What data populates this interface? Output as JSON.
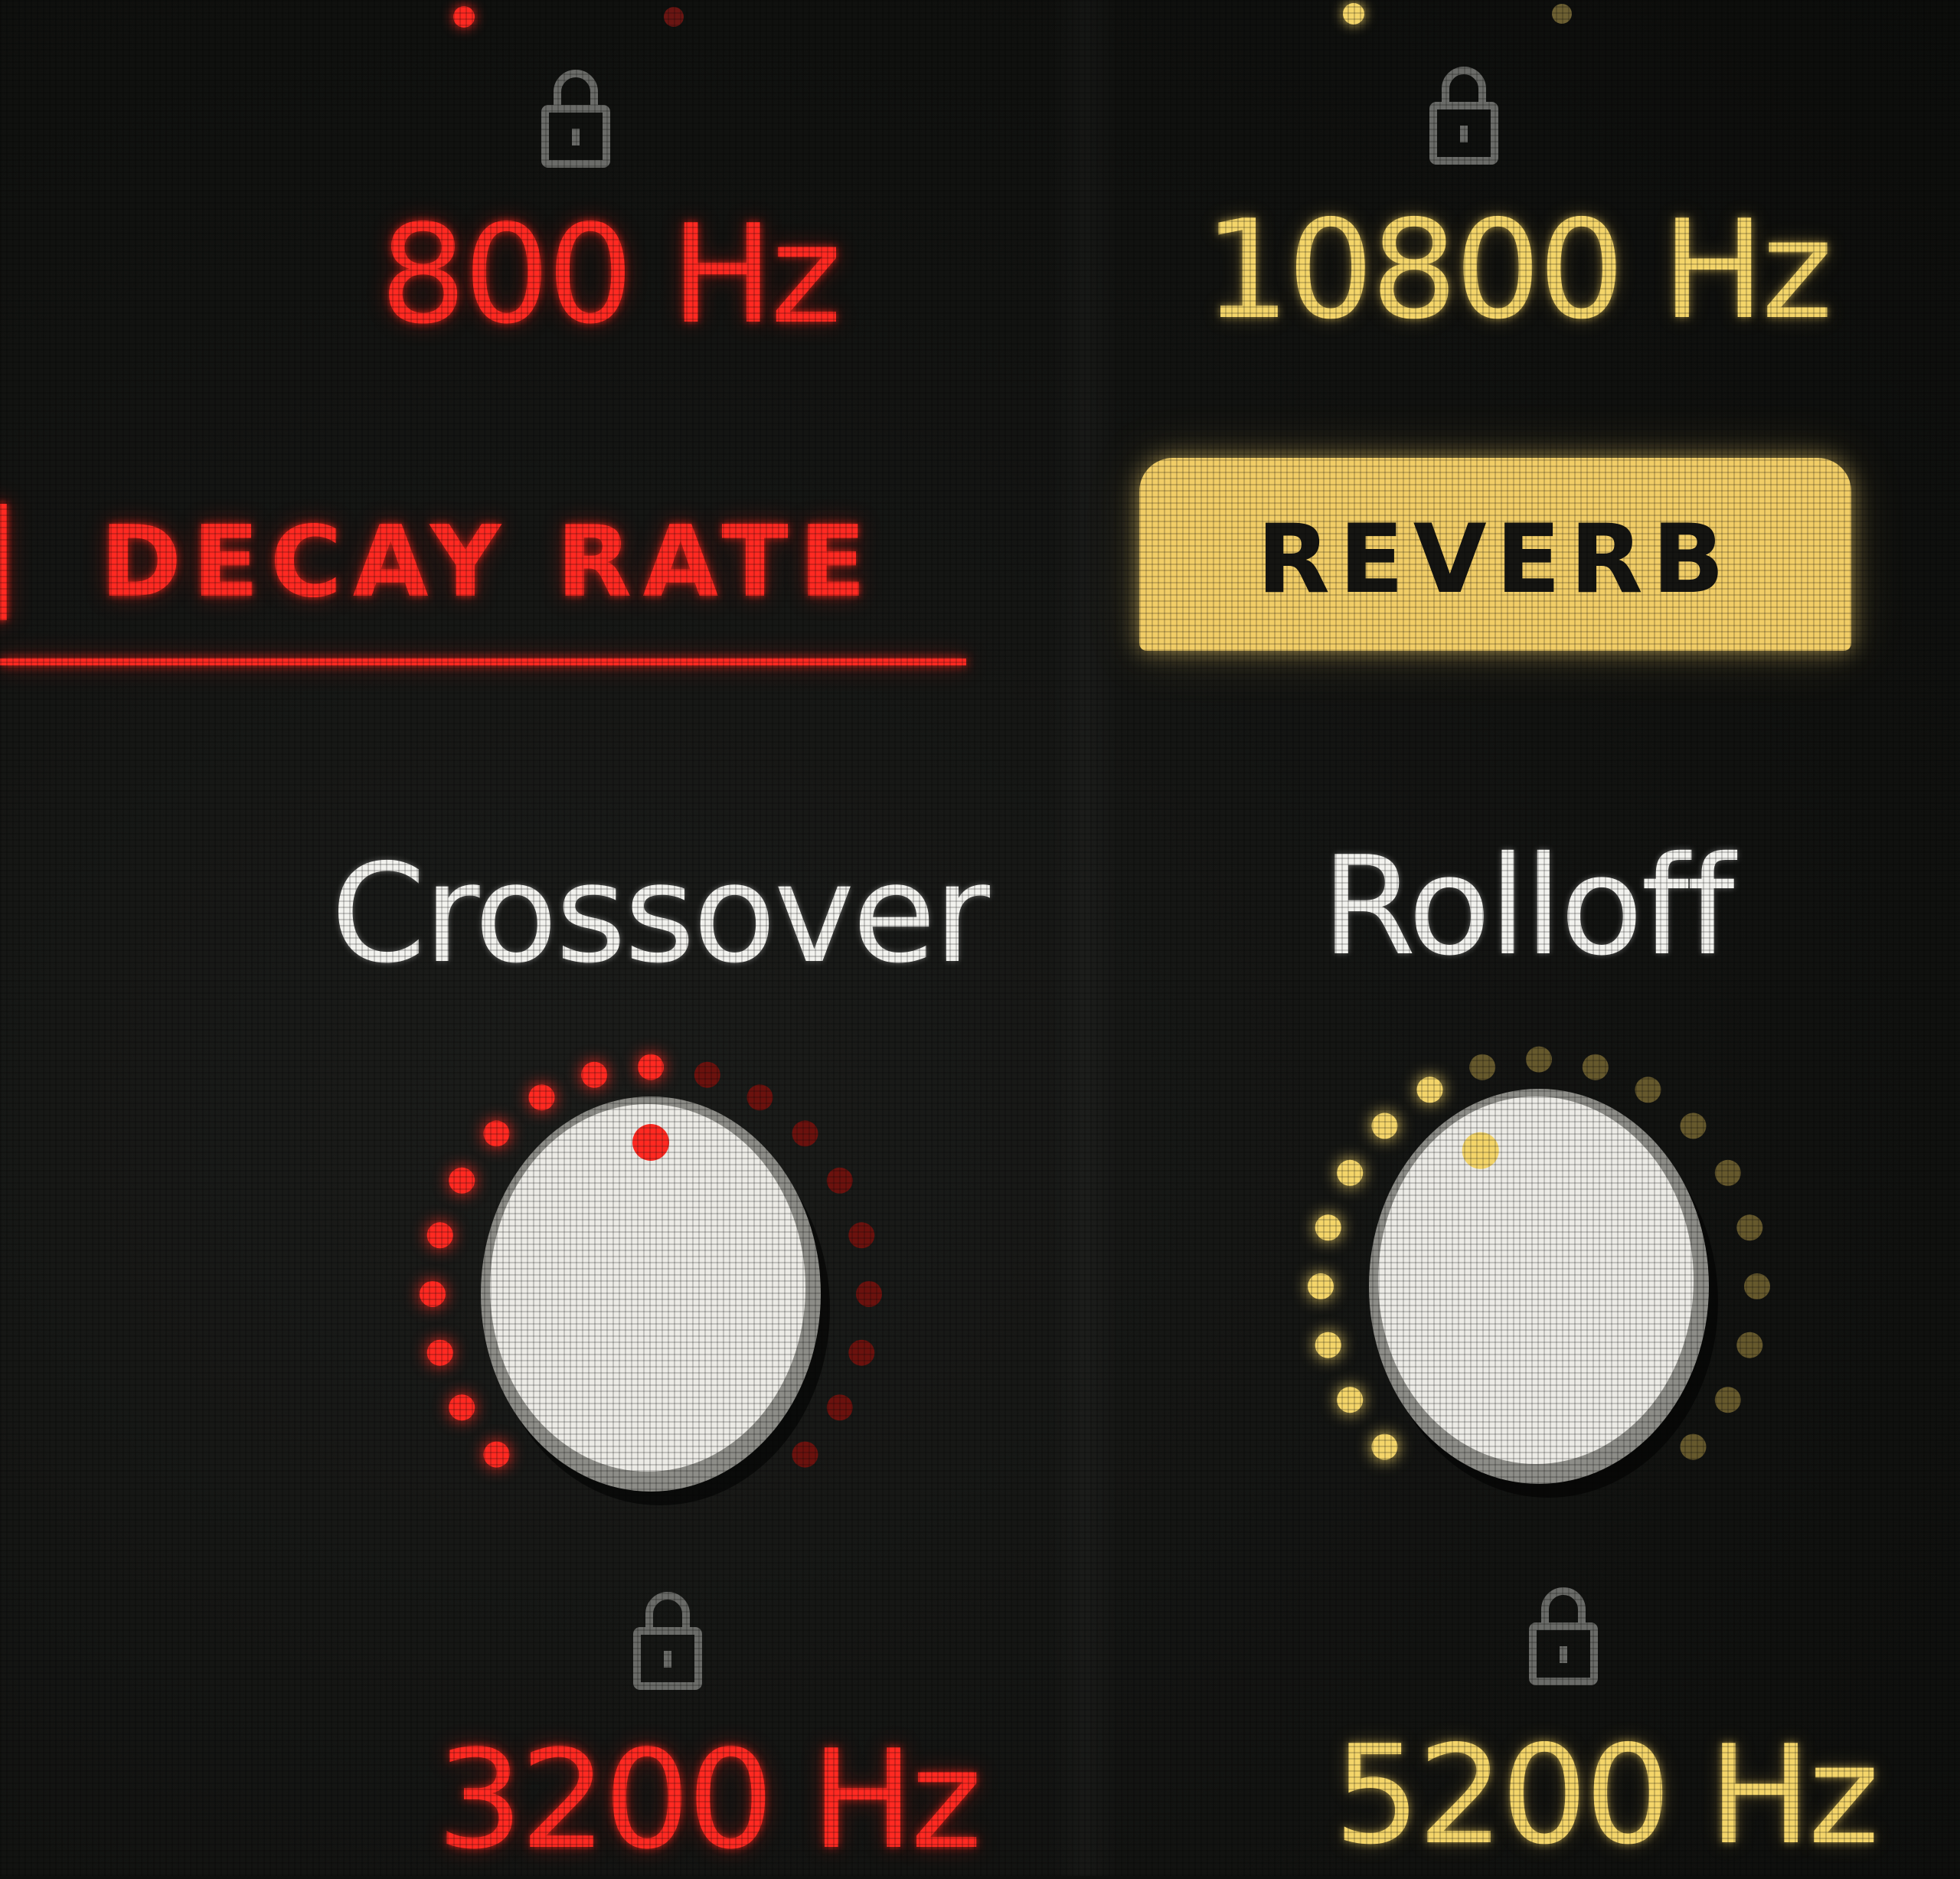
{
  "colors": {
    "red_accent": "#ff2a22",
    "yellow_accent": "#f4d56a",
    "reverb_button_bg": "#f1cd67",
    "background": "#121311",
    "knob_face": "#ecebe6"
  },
  "top_row": {
    "left_value": "800 Hz",
    "right_value": "10800 Hz",
    "left_lock_icon": "lock-icon",
    "right_lock_icon": "lock-icon"
  },
  "sections": {
    "decay_rate_label": "DECAY RATE",
    "reverb_label": "REVERB"
  },
  "knobs": {
    "crossover": {
      "title": "Crossover",
      "value": "3200 Hz",
      "color": "#ff2a22",
      "level": 0.5,
      "icon": "lock-icon"
    },
    "rolloff": {
      "title": "Rolloff",
      "value": "5200 Hz",
      "color": "#f4d56a",
      "level": 0.4,
      "icon": "lock-icon"
    }
  }
}
